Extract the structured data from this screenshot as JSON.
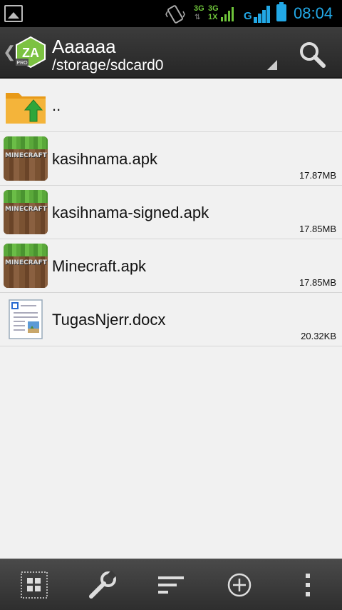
{
  "status_bar": {
    "net_type_1": "3G",
    "net_type_2": "3G",
    "net_type_3": "1X",
    "signal_letter": "G",
    "time": "08:04"
  },
  "header": {
    "title": "Aaaaaa",
    "path": "/storage/sdcard0",
    "logo_text": "ZA",
    "logo_badge": "PRO"
  },
  "files": [
    {
      "name": "..",
      "size": "",
      "icon": "folder-up-icon"
    },
    {
      "name": "kasihnama.apk",
      "size": "17.87MB",
      "icon": "minecraft-apk-icon"
    },
    {
      "name": "kasihnama-signed.apk",
      "size": "17.85MB",
      "icon": "minecraft-apk-icon"
    },
    {
      "name": "Minecraft.apk",
      "size": "17.85MB",
      "icon": "minecraft-apk-icon"
    },
    {
      "name": "TugasNjerr.docx",
      "size": "20.32KB",
      "icon": "document-icon"
    }
  ],
  "icon_text": {
    "minecraft": "MINECRAFT"
  },
  "bottom_bar": [
    "select-all-icon",
    "tools-icon",
    "sort-icon",
    "add-icon",
    "overflow-menu-icon"
  ],
  "colors": {
    "accent": "#22a8e6",
    "signal_green": "#6ec33a"
  }
}
